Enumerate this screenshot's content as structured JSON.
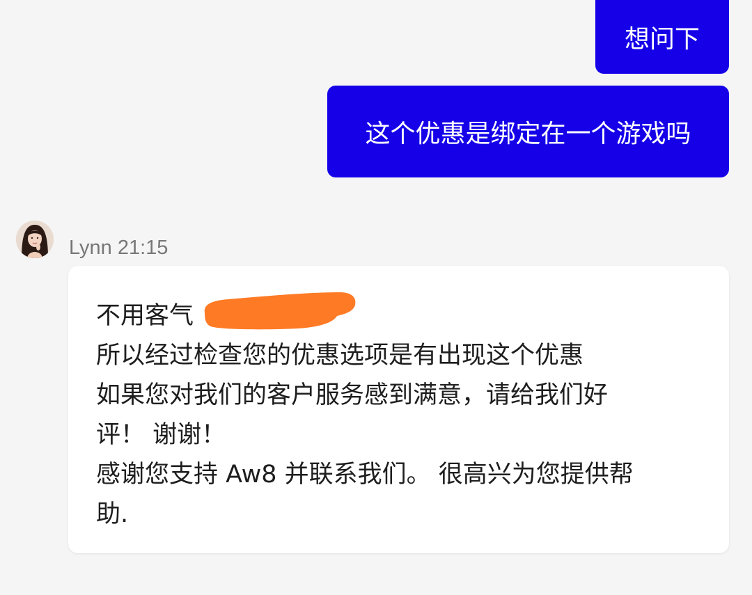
{
  "outgoing": [
    {
      "text": "想问下"
    },
    {
      "text": "这个优惠是绑定在一个游戏吗"
    }
  ],
  "incoming": {
    "sender": "Lynn",
    "time": "21:15",
    "lines": [
      "不用客气",
      "所以经过检查您的优惠选项是有出现这个优惠",
      "如果您对我们的客户服务感到满意，请给我们好",
      "评！ 谢谢！",
      "感谢您支持 Aw8 并联系我们。 很高兴为您提供帮",
      "助."
    ]
  },
  "colors": {
    "background": "#f5f5f5",
    "outgoing_bubble": "#1500e8",
    "incoming_bubble": "#ffffff",
    "redaction": "#ff7a25"
  },
  "icons": {
    "avatar": "agent-avatar-photo"
  }
}
